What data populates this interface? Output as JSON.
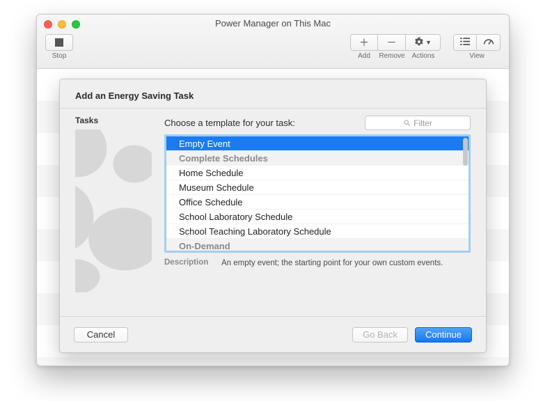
{
  "window": {
    "title": "Power Manager on This Mac"
  },
  "toolbar": {
    "stop_label": "Stop",
    "add_label": "Add",
    "remove_label": "Remove",
    "actions_label": "Actions",
    "view_label": "View"
  },
  "sheet": {
    "title": "Add an Energy Saving Task",
    "left_header": "Tasks",
    "choose_label": "Choose a template for your task:",
    "filter_placeholder": "Filter",
    "description_label": "Description",
    "description_value": "An empty event; the starting point for your own custom events.",
    "list": [
      {
        "label": "Empty Event",
        "kind": "item",
        "selected": true
      },
      {
        "label": "Complete Schedules",
        "kind": "section",
        "selected": false
      },
      {
        "label": "Home Schedule",
        "kind": "item",
        "selected": false
      },
      {
        "label": "Museum Schedule",
        "kind": "item",
        "selected": false
      },
      {
        "label": "Office Schedule",
        "kind": "item",
        "selected": false
      },
      {
        "label": "School Laboratory Schedule",
        "kind": "item",
        "selected": false
      },
      {
        "label": "School Teaching Laboratory Schedule",
        "kind": "item",
        "selected": false
      },
      {
        "label": "On-Demand",
        "kind": "section",
        "selected": false
      }
    ],
    "buttons": {
      "cancel": "Cancel",
      "go_back": "Go Back",
      "continue": "Continue"
    }
  }
}
